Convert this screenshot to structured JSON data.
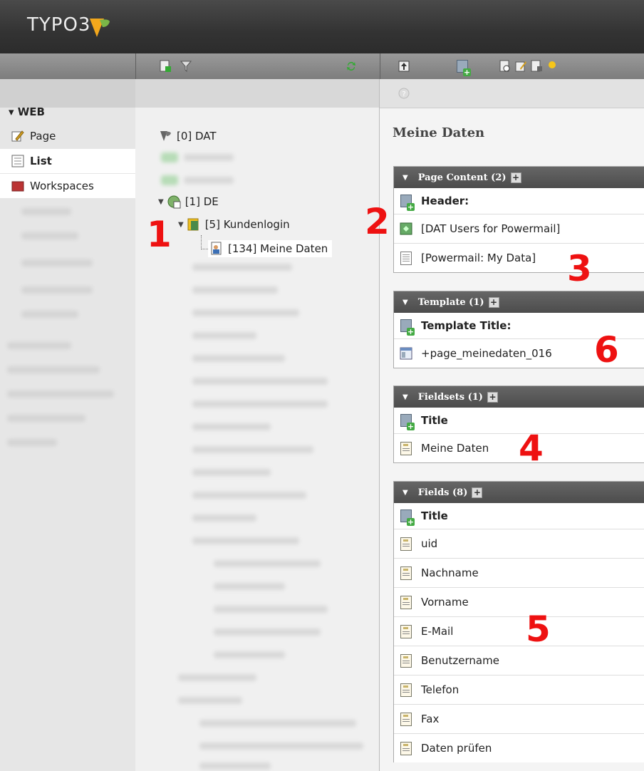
{
  "app": {
    "logo_text": "TYPO3"
  },
  "module_menu": {
    "group": "▾ WEB",
    "items": [
      {
        "label": "Page",
        "icon": "page-edit-icon"
      },
      {
        "label": "List",
        "icon": "list-icon",
        "active": true
      },
      {
        "label": "Workspaces",
        "icon": "workspaces-icon"
      }
    ]
  },
  "page_tree": {
    "nodes": [
      {
        "label": "[0] DAT",
        "icon": "typo3-root-icon"
      },
      {
        "label": "[1] DE",
        "icon": "globe-page-icon"
      },
      {
        "label": "[5] Kundenlogin",
        "icon": "folder-user-icon"
      },
      {
        "label": "[134] Meine Daten",
        "icon": "user-page-icon"
      }
    ]
  },
  "content": {
    "page_title": "Meine Daten",
    "sections": [
      {
        "title": "Page Content (2)",
        "header_label": "Header:",
        "rows": [
          "[DAT Users for Powermail]",
          "[Powermail: My Data]"
        ]
      },
      {
        "title": "Template (1)",
        "header_label": "Template Title:",
        "rows": [
          "+page_meinedaten_016"
        ]
      },
      {
        "title": "Fieldsets (1)",
        "header_label": "Title",
        "rows": [
          "Meine Daten"
        ]
      },
      {
        "title": "Fields (8)",
        "header_label": "Title",
        "rows": [
          "uid",
          "Nachname",
          "Vorname",
          "E-Mail",
          "Benutzername",
          "Telefon",
          "Fax",
          "Daten prüfen"
        ]
      }
    ]
  },
  "annotations": [
    "1",
    "2",
    "3",
    "4",
    "5",
    "6"
  ],
  "colors": {
    "annotation": "#e11111",
    "section_header": "#555555"
  }
}
